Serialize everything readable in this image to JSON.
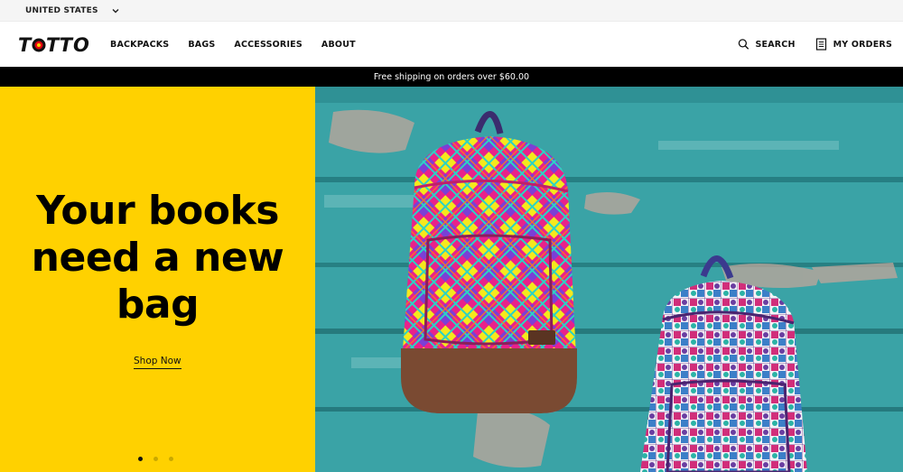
{
  "topbar": {
    "region_label": "UNITED STATES"
  },
  "header": {
    "logo_text": "TOTTO",
    "nav": [
      "BACKPACKS",
      "BAGS",
      "ACCESSORIES",
      "ABOUT"
    ],
    "search_label": "SEARCH",
    "orders_label": "MY ORDERS"
  },
  "promo": {
    "text": "Free shipping on orders over $60.00"
  },
  "hero": {
    "headline_lines": [
      "Your books",
      "need a new",
      "bag"
    ],
    "cta_label": "Shop Now",
    "slide_count": 3,
    "active_slide": 1,
    "image_description": "pink patterned backpack and tile-print backpack on teal wooden wall"
  },
  "colors": {
    "hero_yellow": "#ffd100",
    "promo_black": "#000000",
    "wall_teal": "#3aa3a6"
  },
  "icons": [
    "chevron-down-icon",
    "search-icon",
    "orders-icon"
  ]
}
